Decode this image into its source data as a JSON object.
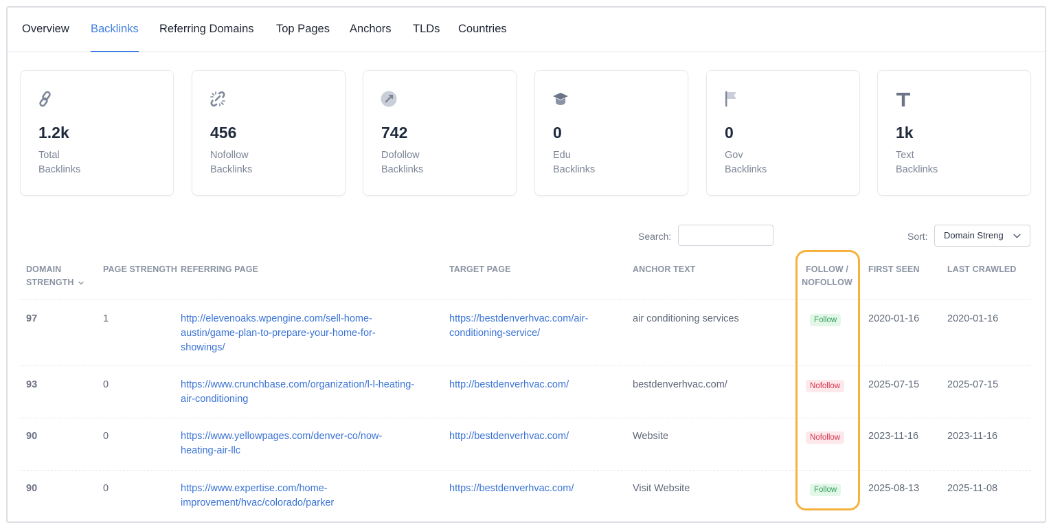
{
  "tabs": [
    "Overview",
    "Backlinks",
    "Referring Domains",
    "Top Pages",
    "Anchors",
    "TLDs",
    "Countries"
  ],
  "active_tab": "Backlinks",
  "stats": [
    {
      "icon": "link-icon",
      "value": "1.2k",
      "label_1": "Total",
      "label_2": "Backlinks"
    },
    {
      "icon": "broken-link-icon",
      "value": "456",
      "label_1": "Nofollow",
      "label_2": "Backlinks"
    },
    {
      "icon": "link-circle-icon",
      "value": "742",
      "label_1": "Dofollow",
      "label_2": "Backlinks"
    },
    {
      "icon": "graduation-cap-icon",
      "value": "0",
      "label_1": "Edu",
      "label_2": "Backlinks"
    },
    {
      "icon": "flag-icon",
      "value": "0",
      "label_1": "Gov",
      "label_2": "Backlinks"
    },
    {
      "icon": "text-t-icon",
      "value": "1k",
      "label_1": "Text",
      "label_2": "Backlinks"
    }
  ],
  "controls": {
    "search_label": "Search:",
    "search_value": "",
    "sort_label": "Sort:",
    "sort_value": "Domain Streng"
  },
  "table": {
    "headers": {
      "domain_strength_1": "DOMAIN",
      "domain_strength_2": "STRENGTH",
      "page_strength": "PAGE STRENGTH",
      "referring_page": "REFERRING PAGE",
      "target_page": "TARGET PAGE",
      "anchor_text": "ANCHOR TEXT",
      "follow_1": "FOLLOW /",
      "follow_2": "NOFOLLOW",
      "first_seen": "FIRST SEEN",
      "last_crawled": "LAST CRAWLED"
    },
    "rows": [
      {
        "domain_strength": "97",
        "page_strength": "1",
        "referring_lines": [
          "http://elevenoaks.wpengine.com/sell-home-",
          "austin/game-plan-to-prepare-your-home-for-",
          "showings/"
        ],
        "target_lines": [
          "https://bestdenverhvac.com/air-",
          "conditioning-service/"
        ],
        "anchor": "air conditioning services",
        "follow": "Follow",
        "first_seen": "2020-01-16",
        "last_crawled": "2020-01-16"
      },
      {
        "domain_strength": "93",
        "page_strength": "0",
        "referring_lines": [
          "https://www.crunchbase.com/organization/l-l-heating-",
          "air-conditioning"
        ],
        "target_lines": [
          "http://bestdenverhvac.com/"
        ],
        "anchor": "bestdenverhvac.com/",
        "follow": "Nofollow",
        "first_seen": "2025-07-15",
        "last_crawled": "2025-07-15"
      },
      {
        "domain_strength": "90",
        "page_strength": "0",
        "referring_lines": [
          "https://www.yellowpages.com/denver-co/now-",
          "heating-air-llc"
        ],
        "target_lines": [
          "http://bestdenverhvac.com/"
        ],
        "anchor": "Website",
        "follow": "Nofollow",
        "first_seen": "2023-11-16",
        "last_crawled": "2023-11-16"
      },
      {
        "domain_strength": "90",
        "page_strength": "0",
        "referring_lines": [
          "https://www.expertise.com/home-",
          "improvement/hvac/colorado/parker"
        ],
        "target_lines": [
          "https://bestdenverhvac.com/"
        ],
        "anchor": "Visit Website",
        "follow": "Follow",
        "first_seen": "2025-08-13",
        "last_crawled": "2025-11-08"
      }
    ]
  },
  "colors": {
    "accent": "#3f7fe0",
    "link": "#3a73d6",
    "highlight": "#f7b13e",
    "follow_bg": "#e3f7e9",
    "follow_text": "#2f9d57",
    "nofollow_bg": "#fde8ec",
    "nofollow_text": "#d6344d"
  }
}
